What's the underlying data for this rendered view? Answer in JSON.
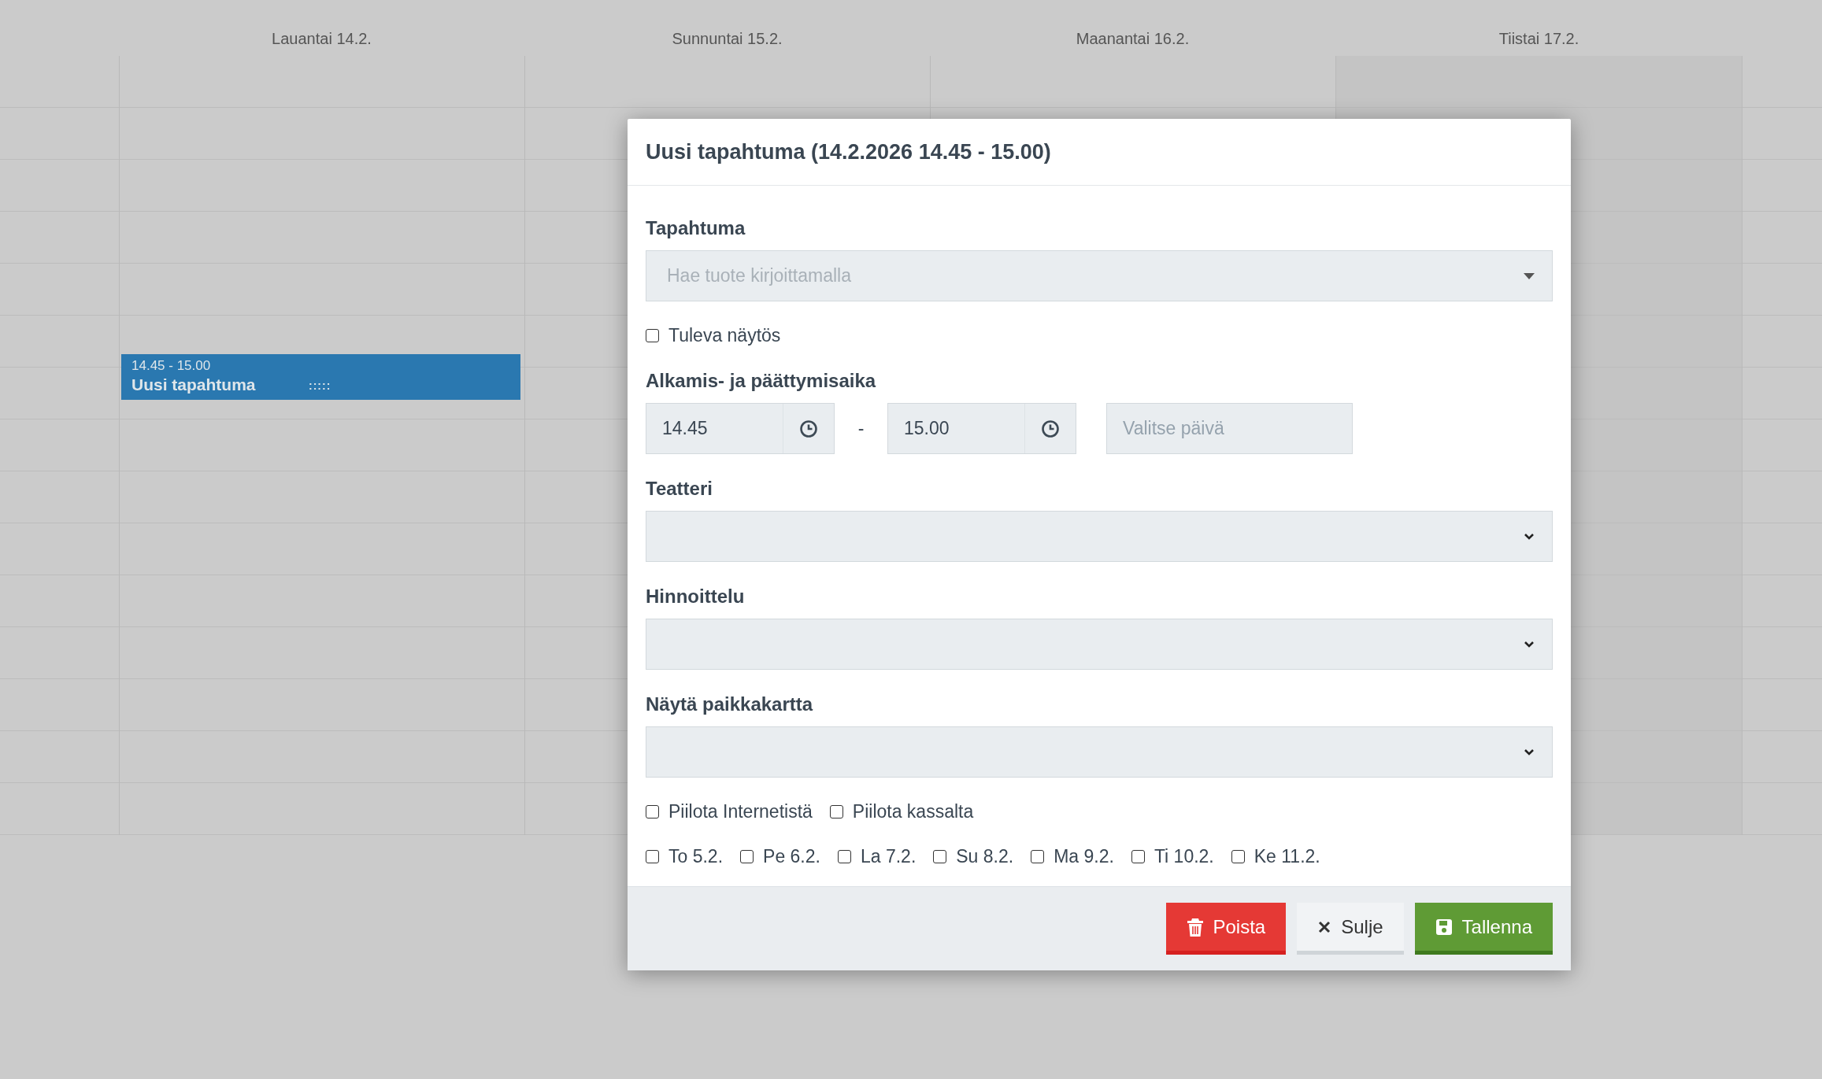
{
  "calendar": {
    "days": [
      {
        "label": "Lauantai 14.2.",
        "shaded": false
      },
      {
        "label": "Sunnuntai 15.2.",
        "shaded": false
      },
      {
        "label": "Maanantai 16.2.",
        "shaded": false
      },
      {
        "label": "Tiistai 17.2.",
        "shaded": true
      }
    ],
    "events": [
      {
        "time": "14.45 - 15.00",
        "title": "Uusi tapahtuma",
        "handle": ":::::"
      }
    ]
  },
  "modal": {
    "title": "Uusi tapahtuma (14.2.2026 14.45 - 15.00)",
    "fields": [
      {
        "kind": "search-select",
        "label": "Tapahtuma",
        "placeholder": "Hae tuote kirjoittamalla"
      },
      {
        "kind": "checks",
        "options": [
          {
            "label": "Tuleva näytös",
            "checked": false
          }
        ]
      },
      {
        "kind": "time-range",
        "label": "Alkamis- ja päättymisaika",
        "start": "14.45",
        "separator": "-",
        "end": "15.00",
        "date_placeholder": "Valitse päivä"
      },
      {
        "kind": "select",
        "label": "Teatteri"
      },
      {
        "kind": "select",
        "label": "Hinnoittelu"
      },
      {
        "kind": "select",
        "label": "Näytä paikkakartta"
      },
      {
        "kind": "checks",
        "options": [
          {
            "label": "Piilota Internetistä",
            "checked": false
          },
          {
            "label": "Piilota kassalta",
            "checked": false
          }
        ]
      },
      {
        "kind": "checks",
        "options": [
          {
            "label": "To 5.2.",
            "checked": false
          },
          {
            "label": "Pe 6.2.",
            "checked": false
          },
          {
            "label": "La 7.2.",
            "checked": false
          },
          {
            "label": "Su 8.2.",
            "checked": false
          },
          {
            "label": "Ma 9.2.",
            "checked": false
          },
          {
            "label": "Ti 10.2.",
            "checked": false
          },
          {
            "label": "Ke 11.2.",
            "checked": false
          }
        ]
      }
    ],
    "buttons": [
      {
        "kind": "danger",
        "label": "Poista"
      },
      {
        "kind": "default",
        "label": "Sulje"
      },
      {
        "kind": "primary",
        "label": "Tallenna"
      }
    ]
  }
}
